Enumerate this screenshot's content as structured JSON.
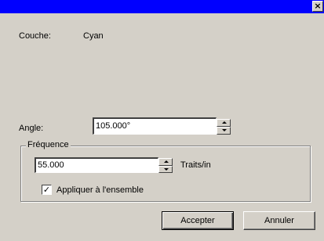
{
  "titlebar": {
    "close_glyph": "×"
  },
  "couche": {
    "label": "Couche:",
    "value": "Cyan"
  },
  "angle": {
    "label": "Angle:",
    "value": "105.000°"
  },
  "frequence": {
    "group_label": "Fréquence",
    "value": "55.000",
    "unit": "Traits/in"
  },
  "apply_all": {
    "label": "Appliquer à l'ensemble",
    "checked": true,
    "check_glyph": "✓"
  },
  "buttons": {
    "accept": "Accepter",
    "cancel": "Annuler"
  },
  "colors": {
    "titlebar": "#0000ff",
    "face": "#d4d0c8"
  }
}
